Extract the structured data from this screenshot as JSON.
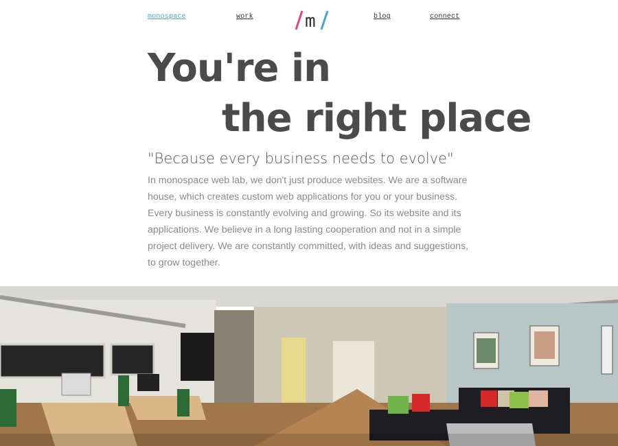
{
  "nav": {
    "items": [
      {
        "label": "monospace",
        "active": true
      },
      {
        "label": "work",
        "active": false
      },
      {
        "label": "blog",
        "active": false
      },
      {
        "label": "connect",
        "active": false
      }
    ],
    "logo_text": "m"
  },
  "hero": {
    "line1": "You're in",
    "line2": "the right place"
  },
  "quote": "\"Because every business needs to evolve\"",
  "intro": "In monospace web lab, we don't just produce websites. We are a software house, which creates custom web applications for you or your business. Every business is constantly evolving and growing. So its website and its applications. We believe in a long lasting cooperation and not in a simple project delivery. We are constantly committed, with ideas and suggestions, to grow together.",
  "colors": {
    "accent_blue": "#4fa6c8",
    "accent_pink": "#e5457b",
    "text_dark": "#4b4b4b",
    "text_muted": "#8a8a8a"
  }
}
